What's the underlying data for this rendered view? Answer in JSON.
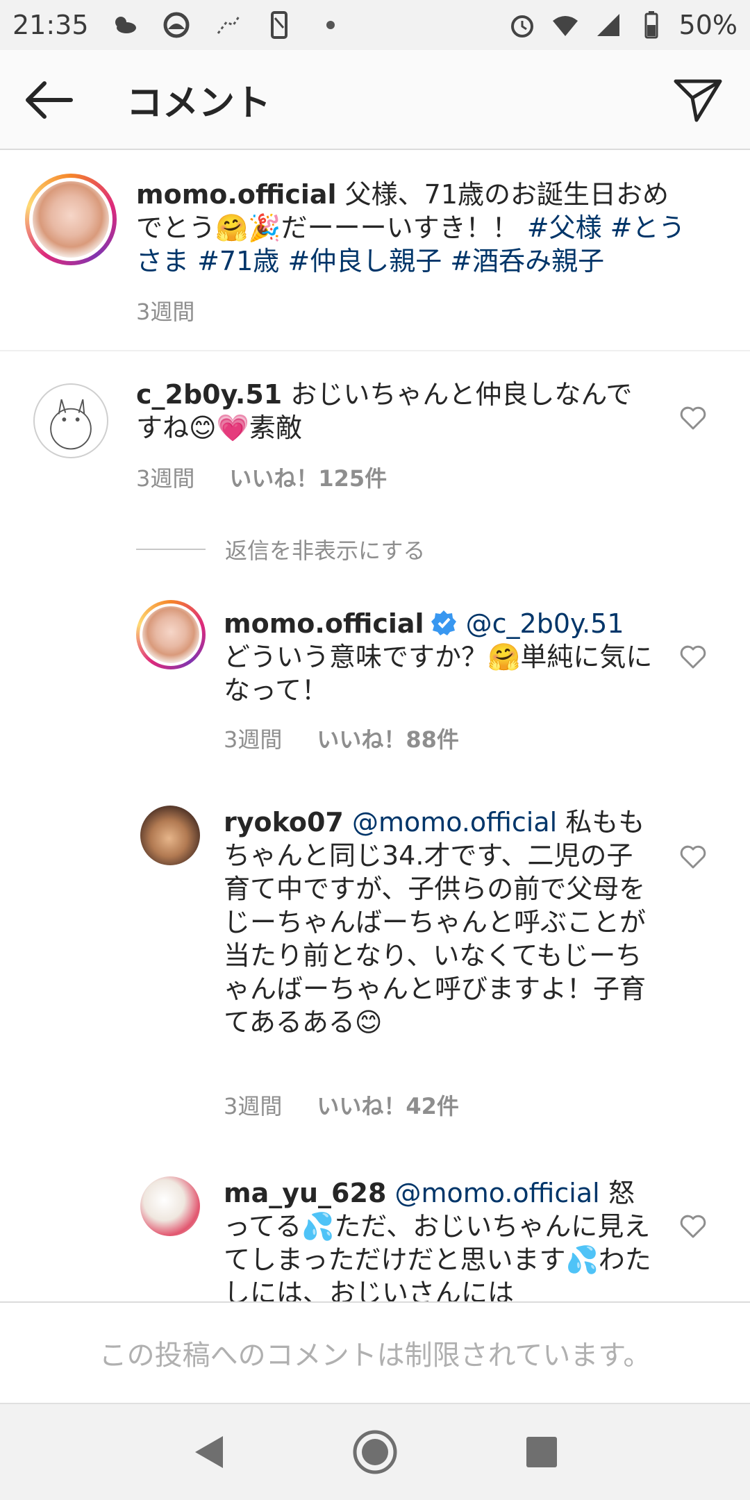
{
  "status_bar": {
    "time": "21:35",
    "battery": "50%"
  },
  "app_bar": {
    "title": "コメント"
  },
  "caption": {
    "username": "momo.official",
    "text": "父様、71歳のお誕生日おめでとう🤗🎉だーーーいすき！！",
    "hashtags": "#父様 #とうさま #71歳 #仲良し親子 #酒呑み親子",
    "time": "3週間"
  },
  "comments": [
    {
      "username": "c_2b0y.51",
      "text": "おじいちゃんと仲良しなんですね😊💗素敵",
      "time": "3週間",
      "likes": "いいね！125件"
    }
  ],
  "hide_replies_label": "返信を非表示にする",
  "replies": [
    {
      "username": "momo.official",
      "mention": "@c_2b0y.51",
      "text": "どういう意味ですか？🤗単純に気になって！",
      "time": "3週間",
      "likes": "いいね！88件"
    },
    {
      "username": "ryoko07",
      "mention": "@momo.official",
      "text": "私ももちゃんと同じ34.才です、二児の子育て中ですが、子供らの前で父母をじーちゃんばーちゃんと呼ぶことが当たり前となり、いなくてもじーちゃんばーちゃんと呼びますよ！子育てあるある😊",
      "time": "3週間",
      "likes": "いいね！42件"
    },
    {
      "username": "ma_yu_628",
      "mention": "@momo.official",
      "text": "怒ってる💦ただ、おじいちゃんに見えてしまっただけだと思います💦わたしには、おじいさんには"
    }
  ],
  "restricted_notice": "この投稿へのコメントは制限されています。",
  "icons": {
    "back": "back-arrow-icon",
    "send": "send-icon",
    "heart": "heart-outline-icon",
    "verified": "verified-badge-icon"
  },
  "colors": {
    "link": "#003569",
    "verified": "#3897f0",
    "muted": "#8e8e8e"
  }
}
